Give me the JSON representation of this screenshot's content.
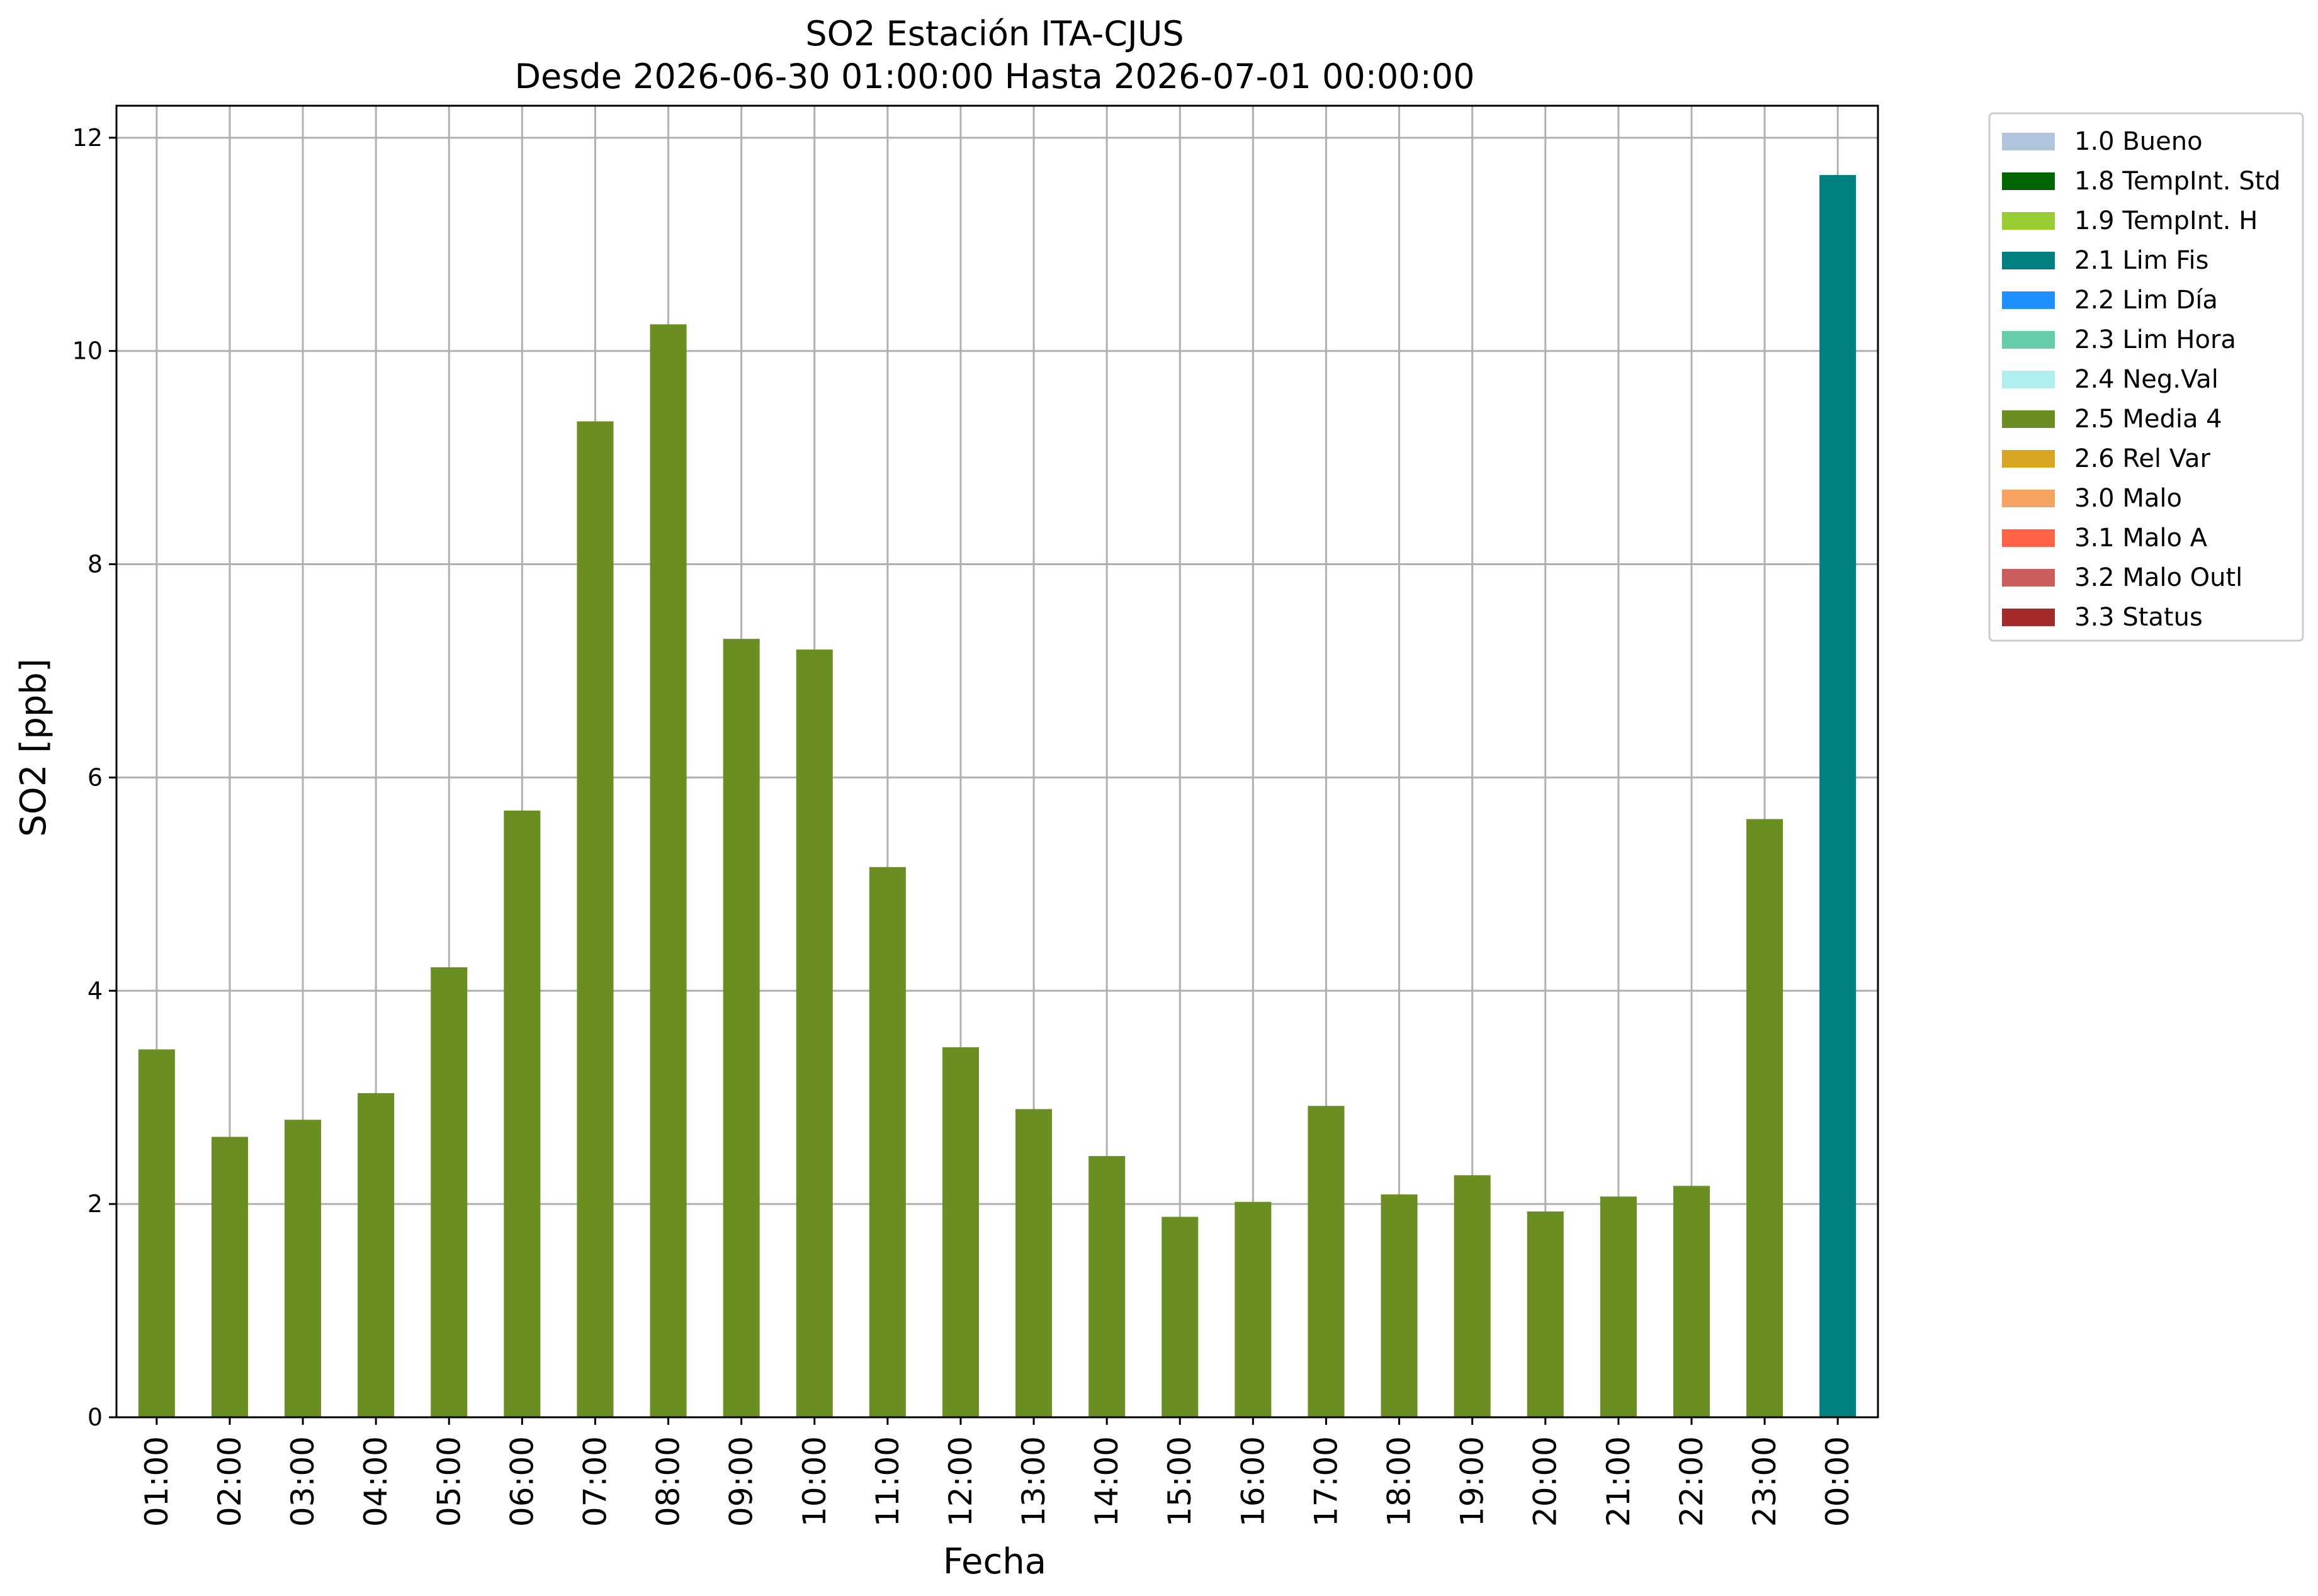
{
  "chart_data": {
    "type": "bar",
    "title": "SO2 Estación ITA-CJUS",
    "subtitle": "Desde 2026-06-30 01:00:00 Hasta 2026-07-01 00:00:00",
    "xlabel": "Fecha",
    "ylabel": "SO2 [ppb]",
    "ylim": [
      0,
      12.3
    ],
    "yticks": [
      0,
      2,
      4,
      6,
      8,
      10,
      12
    ],
    "grid": true,
    "legend_position": "outside-right-top",
    "categories": [
      "01:00",
      "02:00",
      "03:00",
      "04:00",
      "05:00",
      "06:00",
      "07:00",
      "08:00",
      "09:00",
      "10:00",
      "11:00",
      "12:00",
      "13:00",
      "14:00",
      "15:00",
      "16:00",
      "17:00",
      "18:00",
      "19:00",
      "20:00",
      "21:00",
      "22:00",
      "23:00",
      "00:00"
    ],
    "values": [
      3.45,
      2.63,
      2.79,
      3.04,
      4.22,
      5.69,
      9.34,
      10.25,
      7.3,
      7.2,
      5.16,
      3.47,
      2.89,
      2.45,
      1.88,
      2.02,
      2.92,
      2.09,
      2.27,
      1.93,
      2.07,
      2.17,
      5.61,
      11.65
    ],
    "bar_flags": [
      "2.5 Media 4",
      "2.5 Media 4",
      "2.5 Media 4",
      "2.5 Media 4",
      "2.5 Media 4",
      "2.5 Media 4",
      "2.5 Media 4",
      "2.5 Media 4",
      "2.5 Media 4",
      "2.5 Media 4",
      "2.5 Media 4",
      "2.5 Media 4",
      "2.5 Media 4",
      "2.5 Media 4",
      "2.5 Media 4",
      "2.5 Media 4",
      "2.5 Media 4",
      "2.5 Media 4",
      "2.5 Media 4",
      "2.5 Media 4",
      "2.5 Media 4",
      "2.5 Media 4",
      "2.5 Media 4",
      "2.1 Lim Fis"
    ],
    "legend": [
      {
        "label": "1.0 Bueno",
        "color": "#b0c4de"
      },
      {
        "label": "1.8 TempInt. Std",
        "color": "#006400"
      },
      {
        "label": "1.9 TempInt. H",
        "color": "#9acd32"
      },
      {
        "label": "2.1 Lim Fis",
        "color": "#008080"
      },
      {
        "label": "2.2 Lim Día",
        "color": "#1e90ff"
      },
      {
        "label": "2.3 Lim Hora",
        "color": "#66cdaa"
      },
      {
        "label": "2.4 Neg.Val",
        "color": "#afeeee"
      },
      {
        "label": "2.5 Media 4",
        "color": "#6b8e23"
      },
      {
        "label": "2.6 Rel Var",
        "color": "#daa520"
      },
      {
        "label": "3.0 Malo",
        "color": "#f4a460"
      },
      {
        "label": "3.1 Malo A",
        "color": "#ff6347"
      },
      {
        "label": "3.2 Malo Outl",
        "color": "#cd5c5c"
      },
      {
        "label": "3.3 Status",
        "color": "#a52a2a"
      }
    ]
  }
}
